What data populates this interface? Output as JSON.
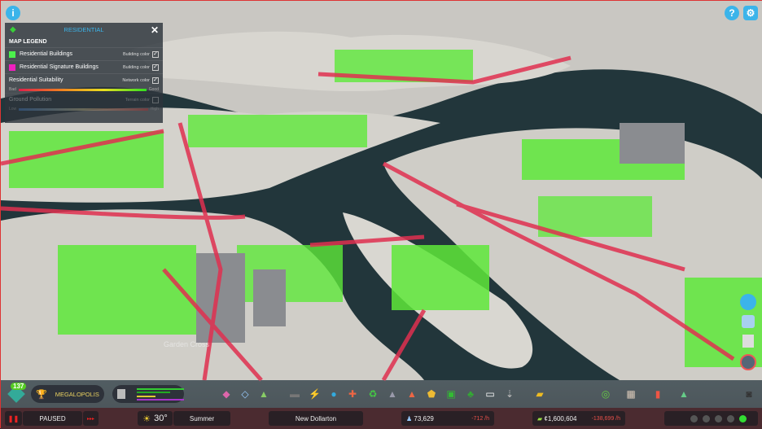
{
  "top": {
    "info_icon": "info-icon",
    "help_icon": "question-icon",
    "settings_icon": "gear-icon"
  },
  "legend": {
    "title": "RESIDENTIAL",
    "section": "MAP LEGEND",
    "items": [
      {
        "label": "Residential Buildings",
        "option": "Building color",
        "color": "#4cf04c",
        "checked": true
      },
      {
        "label": "Residential Signature Buildings",
        "option": "Building color",
        "color": "#f020c0",
        "checked": true
      }
    ],
    "suitability": {
      "label": "Residential Suitability",
      "option": "Network color",
      "checked": true,
      "low": "Bad",
      "high": "Good"
    },
    "pollution": {
      "label": "Ground Pollution",
      "option": "Terrain color",
      "checked": false,
      "low": "Low",
      "high": "High"
    }
  },
  "map": {
    "district_label": "Garden Cross"
  },
  "toolbar": {
    "level": "137",
    "milestone": "MEGALOPOLIS",
    "tools": [
      "zoning",
      "areas",
      "signature-buildings",
      "roads",
      "electricity",
      "water",
      "healthcare",
      "garbage",
      "education",
      "fire",
      "police",
      "transportation",
      "parks",
      "communications",
      "landscaping",
      "bulldozer",
      "city-services",
      "map-tiles",
      "statistics",
      "progression"
    ],
    "photo_mode": "camera-icon"
  },
  "status": {
    "pause_icon": "pause-icon",
    "sim_state": "PAUSED",
    "temperature": "30°",
    "season": "Summer",
    "city_name": "New Dollarton",
    "population": "73,629",
    "population_change": "-712 /h",
    "money": "¢1,600,604",
    "money_change": "-138,699 /h"
  },
  "right_panel": [
    "chirper",
    "citizens",
    "journal",
    "radio"
  ],
  "colors": {
    "accent": "#3bb4ea",
    "residential": "#4cf04c",
    "road_bad": "#e03050",
    "bar_red": "#d8202a"
  }
}
